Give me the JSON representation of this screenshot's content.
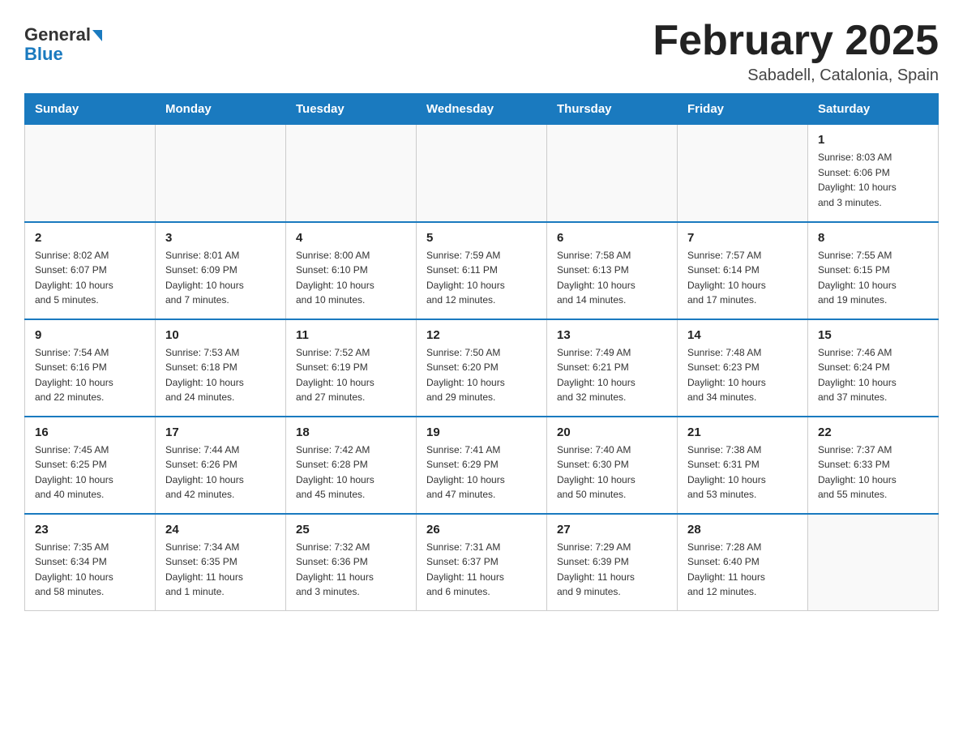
{
  "header": {
    "logo_general": "General",
    "logo_blue": "Blue",
    "month_title": "February 2025",
    "location": "Sabadell, Catalonia, Spain"
  },
  "weekdays": [
    "Sunday",
    "Monday",
    "Tuesday",
    "Wednesday",
    "Thursday",
    "Friday",
    "Saturday"
  ],
  "weeks": [
    [
      {
        "day": "",
        "info": ""
      },
      {
        "day": "",
        "info": ""
      },
      {
        "day": "",
        "info": ""
      },
      {
        "day": "",
        "info": ""
      },
      {
        "day": "",
        "info": ""
      },
      {
        "day": "",
        "info": ""
      },
      {
        "day": "1",
        "info": "Sunrise: 8:03 AM\nSunset: 6:06 PM\nDaylight: 10 hours\nand 3 minutes."
      }
    ],
    [
      {
        "day": "2",
        "info": "Sunrise: 8:02 AM\nSunset: 6:07 PM\nDaylight: 10 hours\nand 5 minutes."
      },
      {
        "day": "3",
        "info": "Sunrise: 8:01 AM\nSunset: 6:09 PM\nDaylight: 10 hours\nand 7 minutes."
      },
      {
        "day": "4",
        "info": "Sunrise: 8:00 AM\nSunset: 6:10 PM\nDaylight: 10 hours\nand 10 minutes."
      },
      {
        "day": "5",
        "info": "Sunrise: 7:59 AM\nSunset: 6:11 PM\nDaylight: 10 hours\nand 12 minutes."
      },
      {
        "day": "6",
        "info": "Sunrise: 7:58 AM\nSunset: 6:13 PM\nDaylight: 10 hours\nand 14 minutes."
      },
      {
        "day": "7",
        "info": "Sunrise: 7:57 AM\nSunset: 6:14 PM\nDaylight: 10 hours\nand 17 minutes."
      },
      {
        "day": "8",
        "info": "Sunrise: 7:55 AM\nSunset: 6:15 PM\nDaylight: 10 hours\nand 19 minutes."
      }
    ],
    [
      {
        "day": "9",
        "info": "Sunrise: 7:54 AM\nSunset: 6:16 PM\nDaylight: 10 hours\nand 22 minutes."
      },
      {
        "day": "10",
        "info": "Sunrise: 7:53 AM\nSunset: 6:18 PM\nDaylight: 10 hours\nand 24 minutes."
      },
      {
        "day": "11",
        "info": "Sunrise: 7:52 AM\nSunset: 6:19 PM\nDaylight: 10 hours\nand 27 minutes."
      },
      {
        "day": "12",
        "info": "Sunrise: 7:50 AM\nSunset: 6:20 PM\nDaylight: 10 hours\nand 29 minutes."
      },
      {
        "day": "13",
        "info": "Sunrise: 7:49 AM\nSunset: 6:21 PM\nDaylight: 10 hours\nand 32 minutes."
      },
      {
        "day": "14",
        "info": "Sunrise: 7:48 AM\nSunset: 6:23 PM\nDaylight: 10 hours\nand 34 minutes."
      },
      {
        "day": "15",
        "info": "Sunrise: 7:46 AM\nSunset: 6:24 PM\nDaylight: 10 hours\nand 37 minutes."
      }
    ],
    [
      {
        "day": "16",
        "info": "Sunrise: 7:45 AM\nSunset: 6:25 PM\nDaylight: 10 hours\nand 40 minutes."
      },
      {
        "day": "17",
        "info": "Sunrise: 7:44 AM\nSunset: 6:26 PM\nDaylight: 10 hours\nand 42 minutes."
      },
      {
        "day": "18",
        "info": "Sunrise: 7:42 AM\nSunset: 6:28 PM\nDaylight: 10 hours\nand 45 minutes."
      },
      {
        "day": "19",
        "info": "Sunrise: 7:41 AM\nSunset: 6:29 PM\nDaylight: 10 hours\nand 47 minutes."
      },
      {
        "day": "20",
        "info": "Sunrise: 7:40 AM\nSunset: 6:30 PM\nDaylight: 10 hours\nand 50 minutes."
      },
      {
        "day": "21",
        "info": "Sunrise: 7:38 AM\nSunset: 6:31 PM\nDaylight: 10 hours\nand 53 minutes."
      },
      {
        "day": "22",
        "info": "Sunrise: 7:37 AM\nSunset: 6:33 PM\nDaylight: 10 hours\nand 55 minutes."
      }
    ],
    [
      {
        "day": "23",
        "info": "Sunrise: 7:35 AM\nSunset: 6:34 PM\nDaylight: 10 hours\nand 58 minutes."
      },
      {
        "day": "24",
        "info": "Sunrise: 7:34 AM\nSunset: 6:35 PM\nDaylight: 11 hours\nand 1 minute."
      },
      {
        "day": "25",
        "info": "Sunrise: 7:32 AM\nSunset: 6:36 PM\nDaylight: 11 hours\nand 3 minutes."
      },
      {
        "day": "26",
        "info": "Sunrise: 7:31 AM\nSunset: 6:37 PM\nDaylight: 11 hours\nand 6 minutes."
      },
      {
        "day": "27",
        "info": "Sunrise: 7:29 AM\nSunset: 6:39 PM\nDaylight: 11 hours\nand 9 minutes."
      },
      {
        "day": "28",
        "info": "Sunrise: 7:28 AM\nSunset: 6:40 PM\nDaylight: 11 hours\nand 12 minutes."
      },
      {
        "day": "",
        "info": ""
      }
    ]
  ]
}
